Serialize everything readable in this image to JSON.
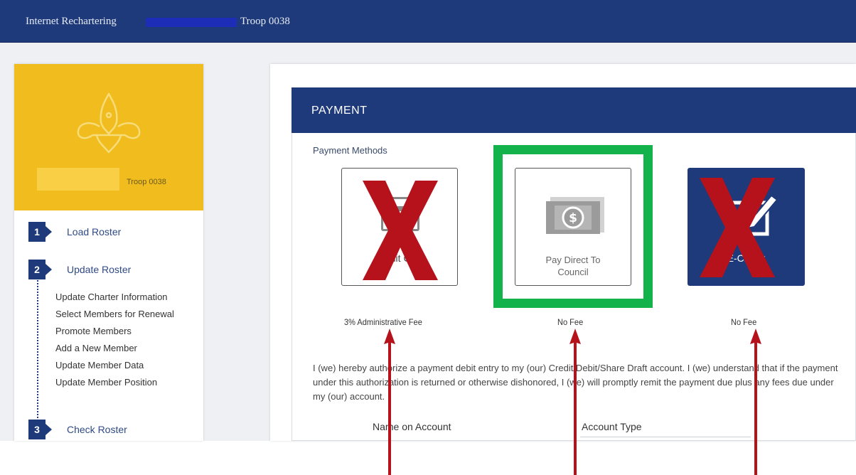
{
  "topbar": {
    "app_title": "Internet Rechartering",
    "unit": "Troop 0038"
  },
  "sidebar": {
    "unit_label": "Troop 0038",
    "steps": [
      {
        "num": "1",
        "label": "Load Roster"
      },
      {
        "num": "2",
        "label": "Update Roster"
      },
      {
        "num": "3",
        "label": "Check Roster"
      }
    ],
    "subitems": [
      "Update Charter Information",
      "Select Members for Renewal",
      "Promote Members",
      "Add a New Member",
      "Update Member Data",
      "Update Member Position"
    ]
  },
  "payment": {
    "title": "PAYMENT",
    "methods_label": "Payment Methods",
    "methods": [
      {
        "label": "Credit Card",
        "fee": "3% Administrative Fee",
        "icon": "credit-card-icon",
        "crossed_out": true
      },
      {
        "label_line1": "Pay Direct To",
        "label_line2": "Council",
        "fee": "No Fee",
        "icon": "money-icon",
        "highlighted": true
      },
      {
        "label": "E-Check",
        "fee": "No Fee",
        "icon": "echeck-icon",
        "crossed_out": true
      }
    ],
    "authorization": "I (we) hereby authorize a payment debit entry to my (our) Credit/Debit/Share Draft account. I (we) understand that if the payment under this authorization is returned or otherwise dishonored, I (we) will promptly remit the payment due plus any fees due under my (our) account.",
    "account_name_label": "Name on Account",
    "account_type_label": "Account Type"
  },
  "colors": {
    "navy": "#1e3a7a",
    "gold": "#f1bc1e",
    "highlight_green": "#13b24a",
    "annotation_red": "#b5121b"
  }
}
